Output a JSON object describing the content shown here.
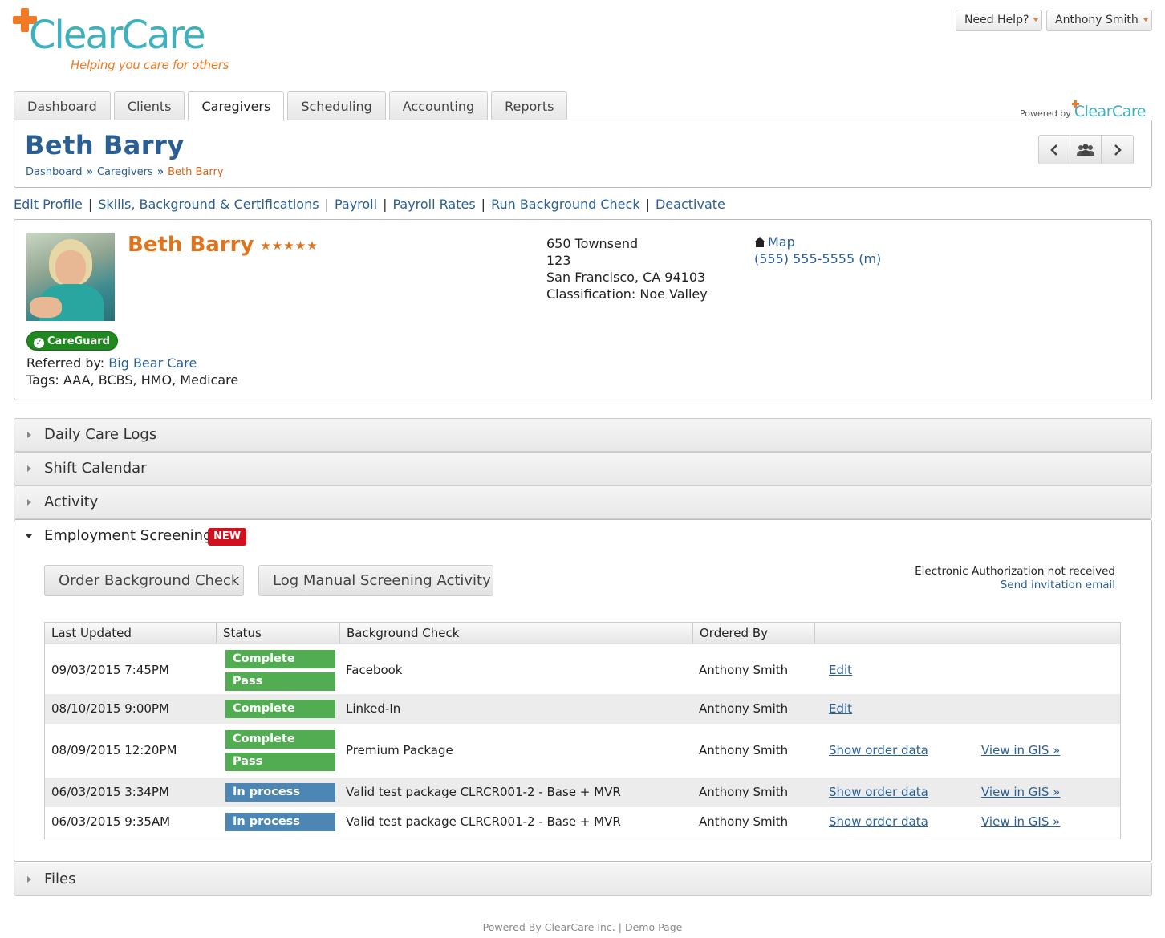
{
  "brand": {
    "name": "ClearCare",
    "tagline": "Helping you care for others",
    "powered_prefix": "Powered by",
    "powered_name": "ClearCare"
  },
  "topbar": {
    "help": "Need Help?",
    "user": "Anthony Smith"
  },
  "tabs": [
    {
      "label": "Dashboard"
    },
    {
      "label": "Clients"
    },
    {
      "label": "Caregivers"
    },
    {
      "label": "Scheduling"
    },
    {
      "label": "Accounting"
    },
    {
      "label": "Reports"
    }
  ],
  "page": {
    "title": "Beth Barry",
    "breadcrumb": [
      "Dashboard",
      "Caregivers",
      "Beth Barry"
    ]
  },
  "actions": [
    "Edit Profile",
    "Skills, Background & Certifications",
    "Payroll",
    "Payroll Rates",
    "Run Background Check",
    "Deactivate"
  ],
  "profile": {
    "name": "Beth Barry",
    "stars": "★★★★★",
    "careguard": "CareGuard",
    "referred_label": "Referred by:",
    "referred_by": "Big Bear Care",
    "tags": "Tags: AAA, BCBS, HMO, Medicare",
    "address": [
      "650 Townsend",
      "123",
      "San Francisco, CA 94103",
      "Classification: Noe Valley"
    ],
    "map": "Map",
    "phone": "(555) 555-5555 (m)"
  },
  "sections": {
    "daily_logs": "Daily Care Logs",
    "shift_calendar": "Shift Calendar",
    "activity": "Activity",
    "files": "Files"
  },
  "screening": {
    "title": "Employment Screening",
    "badge": "NEW",
    "order_btn": "Order Background Check",
    "log_btn": "Log Manual Screening Activity",
    "auth_text": "Electronic Authorization not received",
    "auth_link": "Send invitation email",
    "columns": [
      "Last Updated",
      "Status",
      "Background Check",
      "Ordered By",
      ""
    ],
    "rows": [
      {
        "date": "09/03/2015 7:45PM",
        "status": [
          "Complete",
          "Pass"
        ],
        "check": "Facebook",
        "by": "Anthony Smith",
        "link1": "Edit",
        "link2": ""
      },
      {
        "date": "08/10/2015 9:00PM",
        "status": [
          "Complete"
        ],
        "check": "Linked-In",
        "by": "Anthony Smith",
        "link1": "Edit",
        "link2": ""
      },
      {
        "date": "08/09/2015 12:20PM",
        "status": [
          "Complete",
          "Pass"
        ],
        "check": "Premium Package",
        "by": "Anthony Smith",
        "link1": "Show order data",
        "link2": "View in GIS »"
      },
      {
        "date": "06/03/2015 3:34PM",
        "status": [
          "In process"
        ],
        "check": "Valid test package CLRCR001-2 - Base + MVR",
        "by": "Anthony Smith",
        "link1": "Show order data",
        "link2": "View in GIS »"
      },
      {
        "date": "06/03/2015 9:35AM",
        "status": [
          "In process"
        ],
        "check": "Valid test package CLRCR001-2 - Base + MVR",
        "by": "Anthony Smith",
        "link1": "Show order data",
        "link2": "View in GIS »"
      }
    ]
  },
  "footer": {
    "text": "Powered By ClearCare Inc.",
    "sep": "|",
    "demo": "Demo Page"
  }
}
